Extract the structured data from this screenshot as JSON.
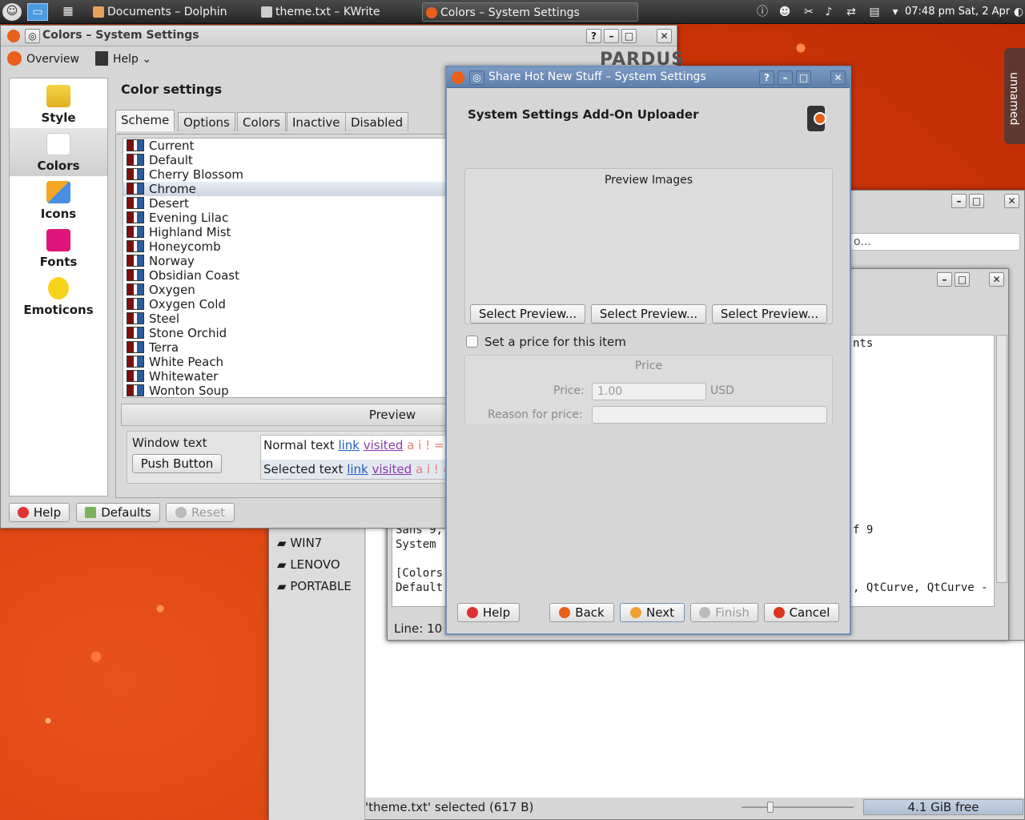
{
  "taskbar": {
    "tasks": [
      {
        "label": "Documents – Dolphin"
      },
      {
        "label": "theme.txt – KWrite"
      },
      {
        "label": "Colors – System Settings"
      }
    ],
    "clock": "07:48 pm Sat, 2 Apr",
    "desktop_widget": "unnamed"
  },
  "colors_window": {
    "title": "Colors – System Settings",
    "toolbar": {
      "overview": "Overview",
      "help": "Help"
    },
    "logo": "PARDUS",
    "categories": [
      {
        "label": "Style"
      },
      {
        "label": "Colors"
      },
      {
        "label": "Icons"
      },
      {
        "label": "Fonts"
      },
      {
        "label": "Emoticons"
      }
    ],
    "heading": "Color settings",
    "tabs": [
      "Scheme",
      "Options",
      "Colors",
      "Inactive",
      "Disabled"
    ],
    "schemes": [
      "Current",
      "Default",
      "Cherry Blossom",
      "Chrome",
      "Desert",
      "Evening Lilac",
      "Highland Mist",
      "Honeycomb",
      "Norway",
      "Obsidian Coast",
      "Oxygen",
      "Oxygen Cold",
      "Steel",
      "Stone Orchid",
      "Terra",
      "White Peach",
      "Whitewater",
      "Wonton Soup"
    ],
    "selected_scheme": "Chrome",
    "preview": {
      "title": "Preview",
      "window_text": "Window text",
      "push_button": "Push Button",
      "normal_text": "Normal text",
      "selected_text": "Selected text",
      "link": "link",
      "visited": "visited",
      "glyphs": "a i ! ="
    },
    "buttons": {
      "help": "Help",
      "defaults": "Defaults",
      "reset": "Reset"
    }
  },
  "dolphin": {
    "places": [
      "WIN7",
      "LENOVO",
      "PORTABLE"
    ],
    "status": "'theme.txt' selected (617 B)",
    "free": "4.1 GiB free"
  },
  "kwrite": {
    "search_placeholder": "o...",
    "lines": [
      "nts",
      "f 9",
      "Sans 9,",
      "System",
      "[Colors",
      "Default",
      ", QtCurve, QtCurve -"
    ],
    "status_line": "Line: 10"
  },
  "uploader": {
    "title": "Share Hot New Stuff – System Settings",
    "heading": "System Settings Add-On Uploader",
    "preview_images": "Preview Images",
    "select_preview": "Select Preview...",
    "set_price": "Set a price for this item",
    "price_group": "Price",
    "price_label": "Price:",
    "price_value": "1.00",
    "currency": "USD",
    "reason_label": "Reason for price:",
    "buttons": {
      "help": "Help",
      "back": "Back",
      "next": "Next",
      "finish": "Finish",
      "cancel": "Cancel"
    }
  }
}
